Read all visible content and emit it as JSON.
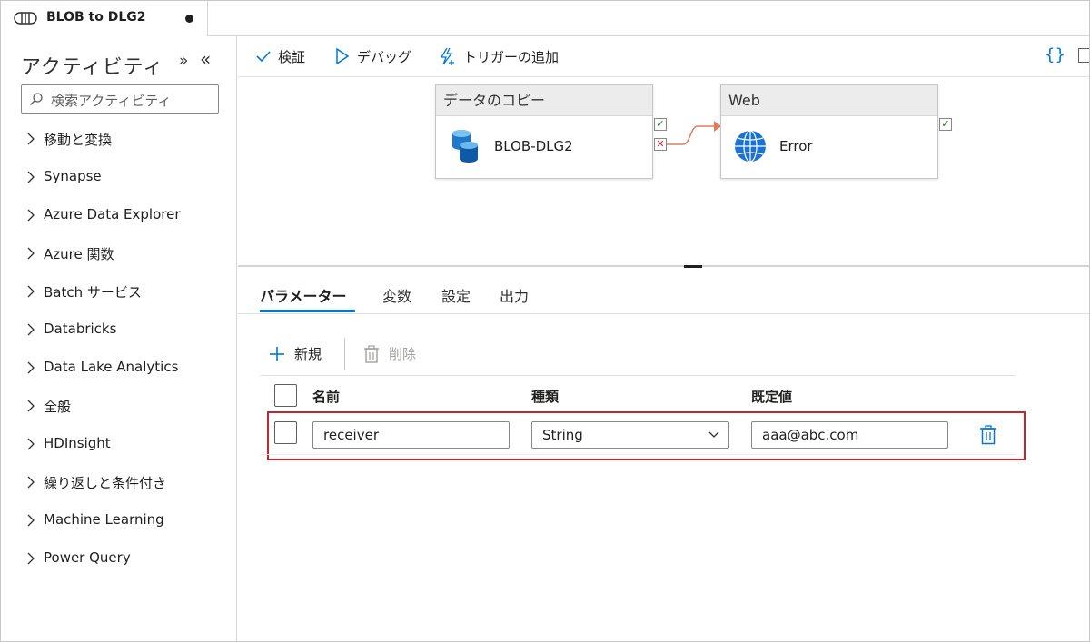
{
  "tab": {
    "title": "BLOB to DLG2"
  },
  "left": {
    "title": "アクティビティ",
    "search_placeholder": "検索アクティビティ",
    "categories": [
      "移動と変換",
      "Synapse",
      "Azure Data Explorer",
      "Azure 関数",
      "Batch サービス",
      "Databricks",
      "Data Lake Analytics",
      "全般",
      "HDInsight",
      "繰り返しと条件付き",
      "Machine Learning",
      "Power Query"
    ]
  },
  "toolbar": {
    "validate": "検証",
    "debug": "デバッグ",
    "add_trigger": "トリガーの追加",
    "code": "{}"
  },
  "canvas": {
    "activity1": {
      "type": "データのコピー",
      "name": "BLOB-DLG2"
    },
    "activity2": {
      "type": "Web",
      "name": "Error"
    }
  },
  "panel": {
    "tabs": [
      "パラメーター",
      "変数",
      "設定",
      "出力"
    ],
    "new_label": "新規",
    "delete_label": "削除",
    "columns": {
      "name": "名前",
      "type": "種類",
      "default": "既定値"
    },
    "row": {
      "name": "receiver",
      "type": "String",
      "default": "aaa@abc.com"
    }
  },
  "colors": {
    "accent": "#0078d4",
    "highlight_border": "#c4262e",
    "success": "#107c10",
    "failure": "#c4262e",
    "connector": "#e07a5f"
  }
}
